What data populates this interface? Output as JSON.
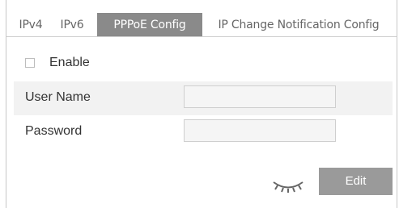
{
  "tabs": [
    "IPv4",
    "IPv6",
    "PPPoE Config",
    "IP Change Notification Config"
  ],
  "active_tab": "PPPoE Config",
  "form": {
    "enable_label": "Enable",
    "enable_checked": false,
    "username_label": "User Name",
    "username_value": "",
    "password_label": "Password",
    "password_value": ""
  },
  "actions": {
    "show_password_icon": "closed-eye-icon",
    "edit_label": "Edit"
  },
  "colors": {
    "active_tab_bg": "#8a8a8a",
    "button_bg": "#9a9a9a",
    "row_alt_bg": "#f2f2f2"
  }
}
